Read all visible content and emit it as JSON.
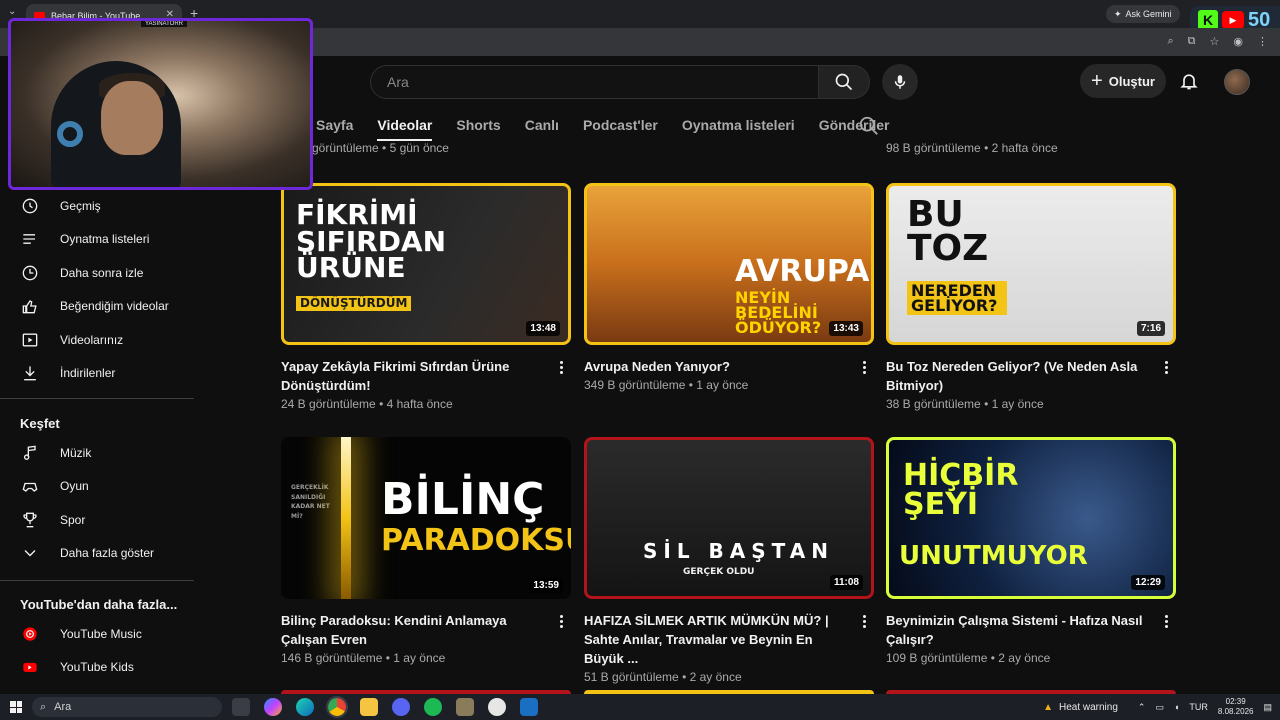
{
  "browser": {
    "tab_title": "Bebar Bilim - YouTube",
    "tab_close": "✕",
    "tab_menu": "⌄",
    "new_tab": "+",
    "ask_gemini": "Ask Gemini",
    "overlay_count": "50"
  },
  "webcam": {
    "tag": "YASINATORR"
  },
  "header": {
    "search_placeholder": "Ara",
    "create_label": "Oluştur"
  },
  "channel_tabs": [
    {
      "label": "Sayfa",
      "active": false
    },
    {
      "label": "Videolar",
      "active": true
    },
    {
      "label": "Shorts",
      "active": false
    },
    {
      "label": "Canlı",
      "active": false
    },
    {
      "label": "Podcast'ler",
      "active": false
    },
    {
      "label": "Oynatma listeleri",
      "active": false
    },
    {
      "label": "Gönderiler",
      "active": false
    }
  ],
  "prev_row": {
    "left_meta": "görüntüleme • 5 gün önce",
    "right_meta": "98 B görüntüleme • 2 hafta önce"
  },
  "sidebar": {
    "you_items": [
      {
        "label": "Geçmiş",
        "icon": "history-icon"
      },
      {
        "label": "Oynatma listeleri",
        "icon": "playlists-icon"
      },
      {
        "label": "Daha sonra izle",
        "icon": "watch-later-icon"
      },
      {
        "label": "Beğendiğim videolar",
        "icon": "like-icon"
      },
      {
        "label": "Videolarınız",
        "icon": "your-videos-icon"
      },
      {
        "label": "İndirilenler",
        "icon": "download-icon"
      }
    ],
    "explore_title": "Keşfet",
    "explore_items": [
      {
        "label": "Müzik",
        "icon": "music-icon"
      },
      {
        "label": "Oyun",
        "icon": "gaming-icon"
      },
      {
        "label": "Spor",
        "icon": "trophy-icon"
      },
      {
        "label": "Daha fazla göster",
        "icon": "chevron-down-icon"
      }
    ],
    "more_title": "YouTube'dan daha fazla...",
    "more_items": [
      {
        "label": "YouTube Music",
        "icon": "youtube-music-icon"
      },
      {
        "label": "YouTube Kids",
        "icon": "youtube-kids-icon"
      }
    ]
  },
  "videos": [
    {
      "thumb_text": "FİKRİMİ SIFIRDAN ÜRÜNE",
      "thumb_sub": "DÖNÜŞTÜRDÜM",
      "duration": "13:48",
      "title": "Yapay Zekâyla Fikrimi Sıfırdan Ürüne Dönüştürdüm!",
      "meta": "24 B görüntüleme • 4 hafta önce"
    },
    {
      "thumb_text": "AVRUPA",
      "thumb_sub": "NEYİN BEDELİNİ ÖDÜYOR?",
      "duration": "13:43",
      "title": "Avrupa Neden Yanıyor?",
      "meta": "349 B görüntüleme • 1 ay önce"
    },
    {
      "thumb_text": "BU TOZ",
      "thumb_sub": "NEREDEN GELİYOR?",
      "duration": "7:16",
      "title": "Bu Toz Nereden Geliyor? (Ve Neden Asla Bitmiyor)",
      "meta": "38 B görüntüleme • 1 ay önce"
    },
    {
      "thumb_text": "BİLİNÇ",
      "thumb_sub": "PARADOKSU",
      "thumb_small": "GERÇEKLİK SANILDIĞI KADAR NET Mİ?",
      "duration": "13:59",
      "title": "Bilinç Paradoksu: Kendini Anlamaya Çalışan Evren",
      "meta": "146 B görüntüleme • 1 ay önce"
    },
    {
      "thumb_text": "SİL BAŞTAN",
      "thumb_sub": "GERÇEK OLDU",
      "duration": "11:08",
      "title": "HAFIZA SİLMEK ARTIK MÜMKÜN MÜ? | Sahte Anılar, Travmalar ve Beynin En Büyük ...",
      "meta": "51 B görüntüleme • 2 ay önce"
    },
    {
      "thumb_text": "HİÇBİR ŞEYİ",
      "thumb_sub": "UNUTMUYOR",
      "duration": "12:29",
      "title": "Beynimizin Çalışma Sistemi - Hafıza Nasıl Çalışır?",
      "meta": "109 B görüntüleme • 2 ay önce"
    }
  ],
  "taskbar": {
    "search_placeholder": "Ara",
    "weather": "Heat warning",
    "lang": "TUR",
    "time": "02:39",
    "date": "8.08.2026"
  },
  "colors": {
    "bg": "#0f0f0f",
    "text": "#f1f1f1",
    "muted": "#aaaaaa",
    "yellow_border": "#f3c316",
    "red_border": "#b3141b",
    "lime_border": "#d6ff3a"
  }
}
